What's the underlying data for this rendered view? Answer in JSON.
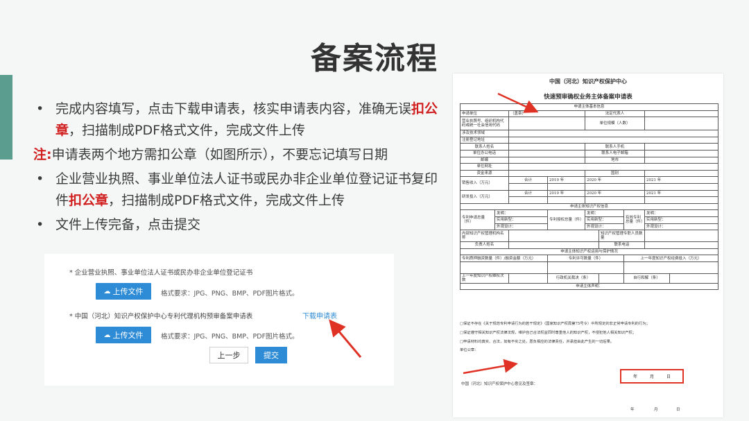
{
  "slide": {
    "title": "备案流程",
    "bullet_mark": "•",
    "b1_pre": "完成内容填写，点击下载申请表，核实申请表内容，准确无误",
    "b1_red": "扣公章",
    "b1_post": "，扫描制成PDF格式文件，完成文件上传",
    "note_label": "注:",
    "note_text": "申请表两个地方需扣公章（如图所示），不要忘记填写日期",
    "b2_pre": "企业营业执照、事业单位法人证书或民办非企业单位登记证书复印件",
    "b2_red": "扣公章",
    "b2_post": "，扫描制成PDF格式文件，完成文件上传",
    "b3": "文件上传完备，点击提交"
  },
  "upload": {
    "field1_label": "* 企业营业执照、事业单位法人证书或民办非企业单位登记证书",
    "upload_btn": "上传文件",
    "format_text": "格式要求：JPG、PNG、BMP、PDF图片格式。",
    "field2_label": "* 中国（河北）知识产权保护中心专利代理机构预审备案申请表",
    "download_link": "下载申请表",
    "prev_btn": "上一步",
    "submit_btn": "提交"
  },
  "doc": {
    "title1": "中国（河北）知识产权保护中心",
    "title2": "快速预审确权业务主体备案申请表",
    "sec_basic": "申请主体基本信息",
    "applicant": "申请单位",
    "seal": "（盖章）",
    "legal_rep": "法定代表人",
    "license": "营业执照号、组织机构代码或统一社会信用代码",
    "unit_type": "单位规模（人数）",
    "industry": "涉及技术领域",
    "reg_addr": "注册登记地址",
    "contact": "联系人姓名",
    "contact_phone": "联系人手机",
    "office_phone": "单位办公电话",
    "contact_email": "联系人电子邮箱",
    "postcode": "邮编",
    "address": "地市",
    "website": "单位网址",
    "fund_source": "资金来源",
    "country": "国别",
    "sales": "销售收入（万元）",
    "rnd": "研发投入（万元）",
    "total": "合计",
    "y2019": "2019 年",
    "y2020": "2020 年",
    "y2021": "2021 年",
    "sec_ip": "申请主体知识产权信息",
    "patent_app": "专利申请总量（件）",
    "patent_grant": "专利授权总量（件）",
    "valid_patent": "有效专利总量（件）",
    "invent": "发明：",
    "utility": "实用新型：",
    "design": "外观设计：",
    "ip_mgmt": "内部知识产权管理机构名称",
    "ip_staff": "知识产权管理专职人员数量",
    "ip_head": "负责人姓名",
    "ip_head_phone": "联系电话",
    "sec_use": "申请主体知识产权运用与保护情况",
    "pledge": "专利质押融资数量（件）/融资金额（万元）",
    "license_cnt": "专利许可数量（件）",
    "ip_cost": "上一年度知识产权经费投入（万元）",
    "last_year_dispute": "上一年度知识产权维权次数",
    "admin_case": "行政机关裁决（条）",
    "self_settle": "自行和解（条）",
    "sec_decl": "申请主体声明：",
    "decl1": "□保证不存在《关于规范专利申请行为的若干规定》（国家知识产权局第75号令）中所规定的非正常申请专利的行为；",
    "decl2": "□保证遵守相关知识产权法律法规，维护自己合法权益同时尊重他人的知识产权，不侵犯他人相关知识产权；",
    "decl3": "□申请材料均真实、合法，如有不实之处，愿负相应的法律责任，并承担由此产生的一切后果。",
    "unit_seal": "单位公章：",
    "year": "年",
    "month": "月",
    "day": "日",
    "center_opinion": "中国（河北）知识产权保护中心意见及签章："
  },
  "colors": {
    "accent": "#5b9e8f",
    "highlight_red": "#d11e1e",
    "button_blue": "#2e8bd6",
    "arrow_red": "#e03224"
  }
}
